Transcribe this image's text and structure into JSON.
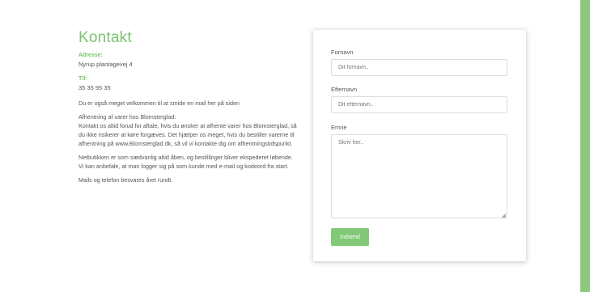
{
  "contact": {
    "title": "Kontakt",
    "address_label": "Adresse:",
    "address_value": "Nyrup plantagevej 4",
    "phone_label": "Tlf:",
    "phone_value": "35 35 95 35",
    "paragraphs": [
      "Du er også meget velkommen til at smide en mail her på siden",
      "Afhentning af varer hos Blomsterglad:\nKontakt os altid forud for aftale, hvis du ønsker at afhente varer hos Blomsterglad, så du ikke risikerer at køre forgæves. Det hjælper os meget, hvis du bestiller varerne til afhentning på www.Blomsterglad.dk, så vil vi kontakte dig om afhentningstidspunkt.",
      "Netbutikken er som sædvanlig altid åben, og bestillinger bliver ekspederet løbende. Vi kan anbefale, at man logger sig på som kunde med e-mail og kodeord fra start.",
      "Mails og telefon besvares året rundt."
    ]
  },
  "form": {
    "firstname_label": "Fornavn",
    "firstname_placeholder": "Dit fornavn..",
    "lastname_label": "Efternavn",
    "lastname_placeholder": "Dit efternavn..",
    "subject_label": "Emne",
    "subject_placeholder": "Skriv her..",
    "submit_label": "Indsend"
  },
  "colors": {
    "accent": "#7cc36f",
    "sidebar": "#8cc97f"
  }
}
